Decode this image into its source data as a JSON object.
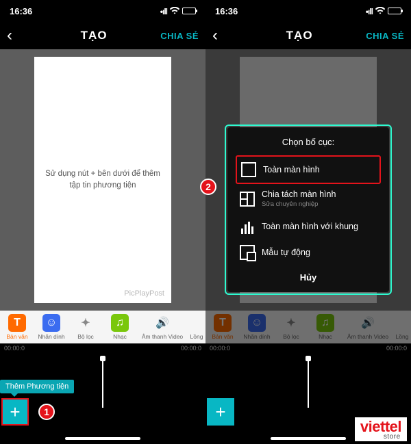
{
  "status": {
    "time": "16:36"
  },
  "nav": {
    "title": "TẠO",
    "share": "CHIA SẺ"
  },
  "preview": {
    "placeholder": "Sử dụng nút + bên dưới để thêm tập tin phương tiện",
    "watermark": "PicPlayPost"
  },
  "tools": {
    "text": {
      "label": "Bản văn",
      "glyph": "T"
    },
    "sticker": {
      "label": "Nhãn dính",
      "glyph": "☺"
    },
    "filter": {
      "label": "Bộ lọc",
      "glyph": "✦"
    },
    "music": {
      "label": "Nhạc",
      "glyph": "♫"
    },
    "sound": {
      "label": "Âm thanh Video",
      "glyph": "🔊"
    },
    "overflow": {
      "label": "Lồng"
    }
  },
  "timeline": {
    "start": "00:00:0",
    "end": "00:00:0"
  },
  "tooltip": "Thêm Phương tiện",
  "dialog": {
    "title": "Chọn bố cục:",
    "full": "Toàn màn hình",
    "split": "Chia tách màn hình",
    "split_sub": "Sửa chuyên nghiệp",
    "frame": "Toàn màn hình với khung",
    "auto": "Mẫu tự động",
    "cancel": "Hủy"
  },
  "steps": {
    "one": "1",
    "two": "2"
  },
  "brand": {
    "main": "viettel",
    "sub": "store"
  }
}
